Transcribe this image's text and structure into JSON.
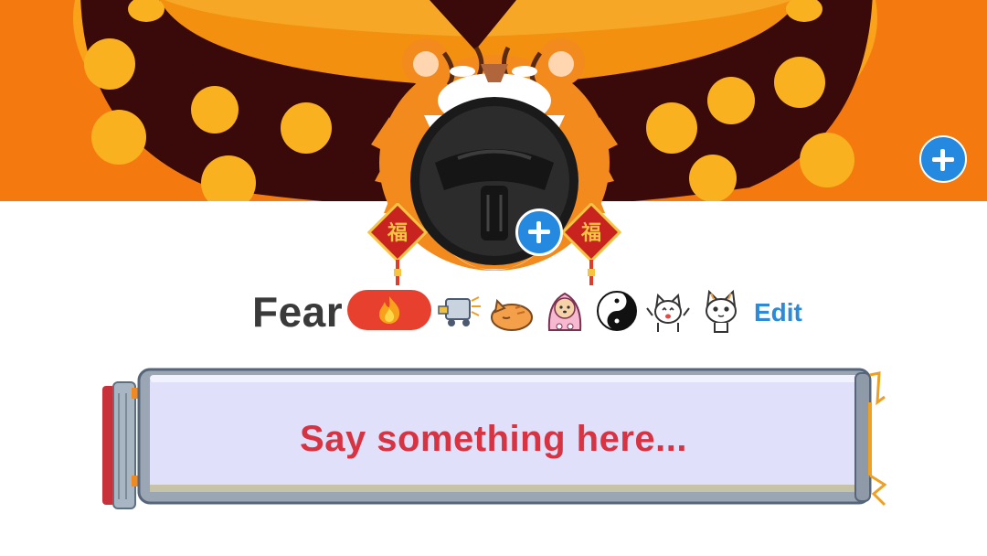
{
  "profile": {
    "name": "Fear",
    "edit_label": "Edit",
    "charm_glyph": "福"
  },
  "status_input": {
    "placeholder": "Say something here..."
  },
  "icons": {
    "cover_add": "plus-circle-icon",
    "avatar_add": "plus-circle-icon",
    "fire_badge": "fire-icon",
    "stickers": [
      "cart-sticker",
      "sleeping-cat-sticker",
      "shiba-blanket-sticker",
      "yin-yang-cats-sticker",
      "cheering-cat-sticker",
      "thinking-cat-sticker"
    ]
  },
  "colors": {
    "accent_blue": "#2589e0",
    "name_text": "#3a3a3a",
    "edit_link": "#2c8ad8",
    "placeholder_text": "#d63343",
    "fire_badge": "#e8402e",
    "cover_orange": "#f47a10",
    "input_fill": "#e1e0fa"
  }
}
